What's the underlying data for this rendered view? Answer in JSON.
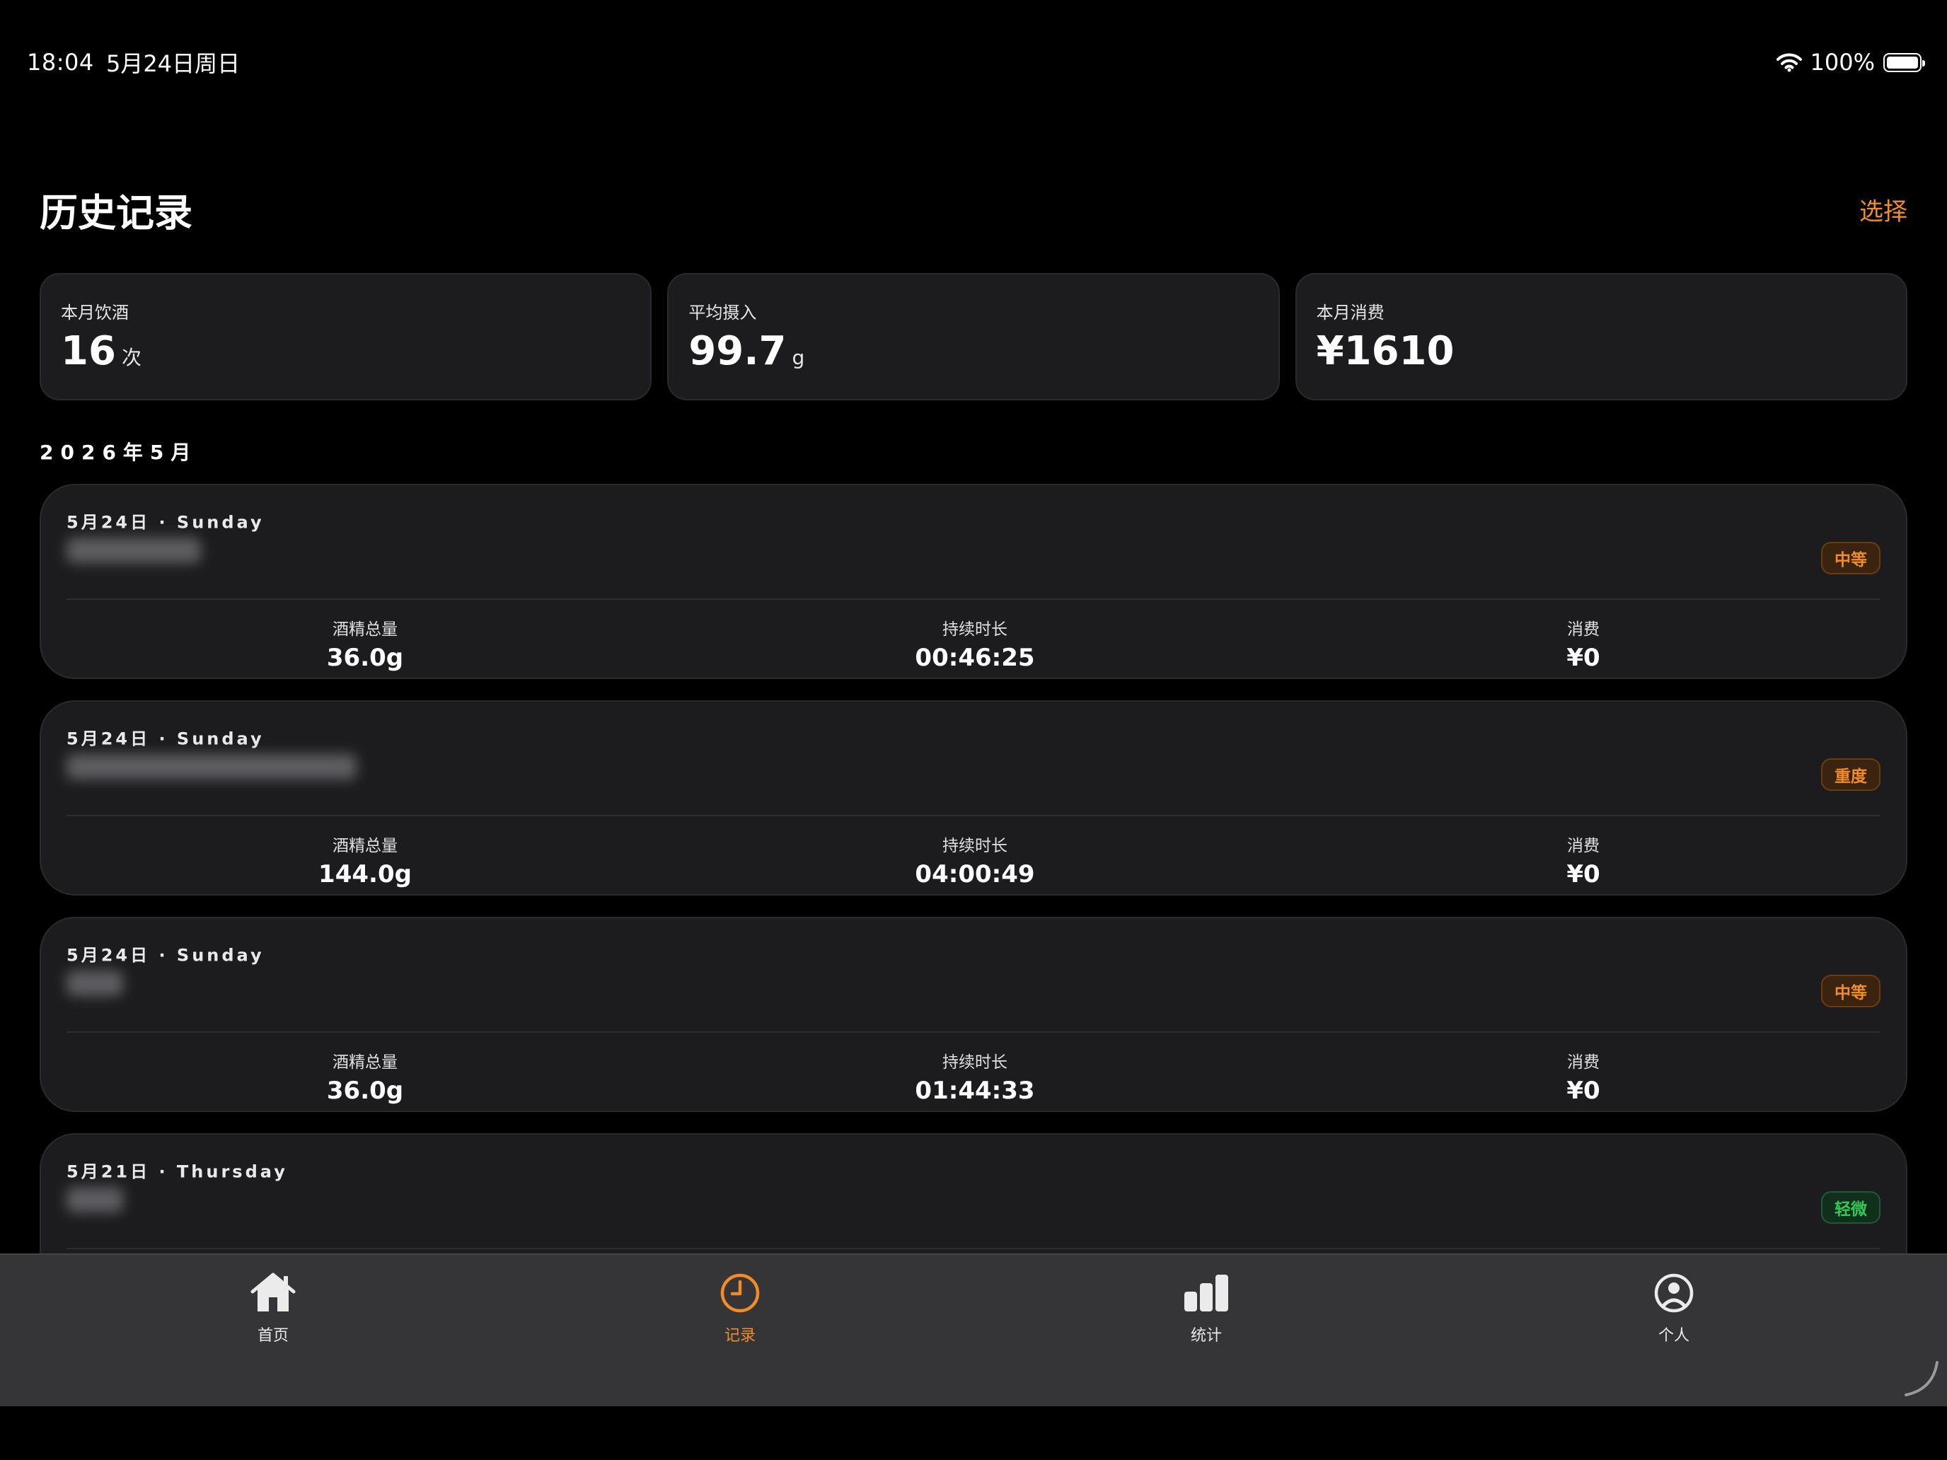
{
  "status_bar": {
    "time": "18:04",
    "date": "5月24日周日",
    "battery": "100%",
    "icons": [
      "wifi-icon",
      "battery-icon"
    ]
  },
  "header": {
    "title": "历史记录",
    "select_label": "选择",
    "accent_color": "#F28C28"
  },
  "summary": [
    {
      "label": "本月饮酒",
      "value": "16",
      "unit": "次"
    },
    {
      "label": "平均摄入",
      "value": "99.7",
      "unit": "g"
    },
    {
      "label": "本月消费",
      "value": "¥1610",
      "unit": ""
    }
  ],
  "month_heading": "2026年5月",
  "records": [
    {
      "date": "5月24日 · Sunday",
      "level": "中等",
      "level_color": "#F28C28",
      "alcohol_label": "酒精总量",
      "alcohol": "36.0g",
      "duration_label": "持续时长",
      "duration": "00:46:25",
      "cost_label": "消费",
      "cost": "¥0"
    },
    {
      "date": "5月24日 · Sunday",
      "level": "重度",
      "level_color": "#F28C28",
      "alcohol_label": "酒精总量",
      "alcohol": "144.0g",
      "duration_label": "持续时长",
      "duration": "04:00:49",
      "cost_label": "消费",
      "cost": "¥0"
    },
    {
      "date": "5月24日 · Sunday",
      "level": "中等",
      "level_color": "#F28C28",
      "alcohol_label": "酒精总量",
      "alcohol": "36.0g",
      "duration_label": "持续时长",
      "duration": "01:44:33",
      "cost_label": "消费",
      "cost": "¥0"
    },
    {
      "date": "5月21日 · Thursday",
      "level": "轻微",
      "level_color": "#34C759"
    }
  ],
  "tab_bar": {
    "tabs": [
      {
        "label": "首页",
        "icon": "house-icon",
        "active": false
      },
      {
        "label": "记录",
        "icon": "clock-icon",
        "active": true
      },
      {
        "label": "统计",
        "icon": "bar-chart-icon",
        "active": false
      },
      {
        "label": "个人",
        "icon": "person-circle-icon",
        "active": false
      }
    ]
  }
}
